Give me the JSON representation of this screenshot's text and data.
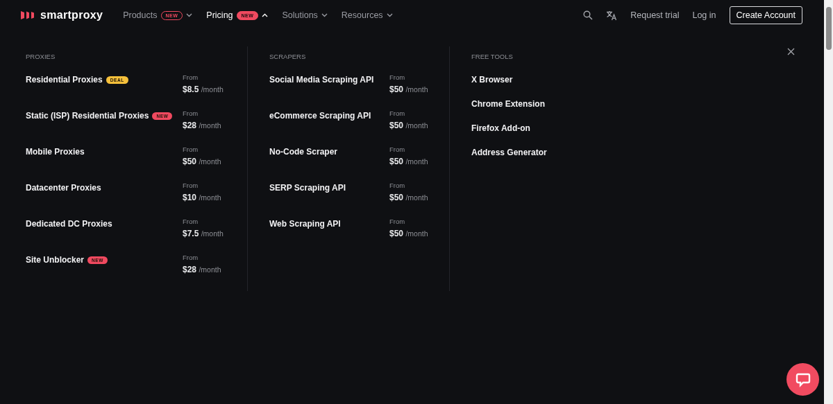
{
  "brand": {
    "name": "smartproxy"
  },
  "nav": [
    {
      "label": "Products",
      "badge": "NEW",
      "selected": false
    },
    {
      "label": "Pricing",
      "badge": "NEW",
      "selected": true
    },
    {
      "label": "Solutions",
      "selected": false
    },
    {
      "label": "Resources",
      "selected": false
    }
  ],
  "actions": {
    "request_trial": "Request trial",
    "login": "Log in",
    "create_account": "Create Account"
  },
  "menu": {
    "columns": [
      {
        "heading": "PROXIES",
        "items": [
          {
            "name": "Residential Proxies",
            "badge": {
              "text": "DEAL",
              "kind": "deal"
            },
            "from": "From",
            "price": "$8.5",
            "unit": "/month"
          },
          {
            "name": "Static (ISP) Residential Proxies",
            "badge": {
              "text": "NEW",
              "kind": "new"
            },
            "from": "From",
            "price": "$28",
            "unit": "/month"
          },
          {
            "name": "Mobile Proxies",
            "from": "From",
            "price": "$50",
            "unit": "/month"
          },
          {
            "name": "Datacenter Proxies",
            "from": "From",
            "price": "$10",
            "unit": "/month"
          },
          {
            "name": "Dedicated DC Proxies",
            "from": "From",
            "price": "$7.5",
            "unit": "/month"
          },
          {
            "name": "Site Unblocker",
            "badge": {
              "text": "NEW",
              "kind": "new"
            },
            "from": "From",
            "price": "$28",
            "unit": "/month"
          }
        ]
      },
      {
        "heading": "SCRAPERS",
        "items": [
          {
            "name": "Social Media Scraping API",
            "from": "From",
            "price": "$50",
            "unit": "/month"
          },
          {
            "name": "eCommerce Scraping API",
            "from": "From",
            "price": "$50",
            "unit": "/month"
          },
          {
            "name": "No-Code Scraper",
            "from": "From",
            "price": "$50",
            "unit": "/month"
          },
          {
            "name": "SERP Scraping API",
            "from": "From",
            "price": "$50",
            "unit": "/month"
          },
          {
            "name": "Web Scraping API",
            "from": "From",
            "price": "$50",
            "unit": "/month"
          }
        ]
      },
      {
        "heading": "FREE TOOLS",
        "items": [
          {
            "name": "X Browser"
          },
          {
            "name": "Chrome Extension"
          },
          {
            "name": "Firefox Add-on"
          },
          {
            "name": "Address Generator"
          }
        ]
      }
    ]
  }
}
